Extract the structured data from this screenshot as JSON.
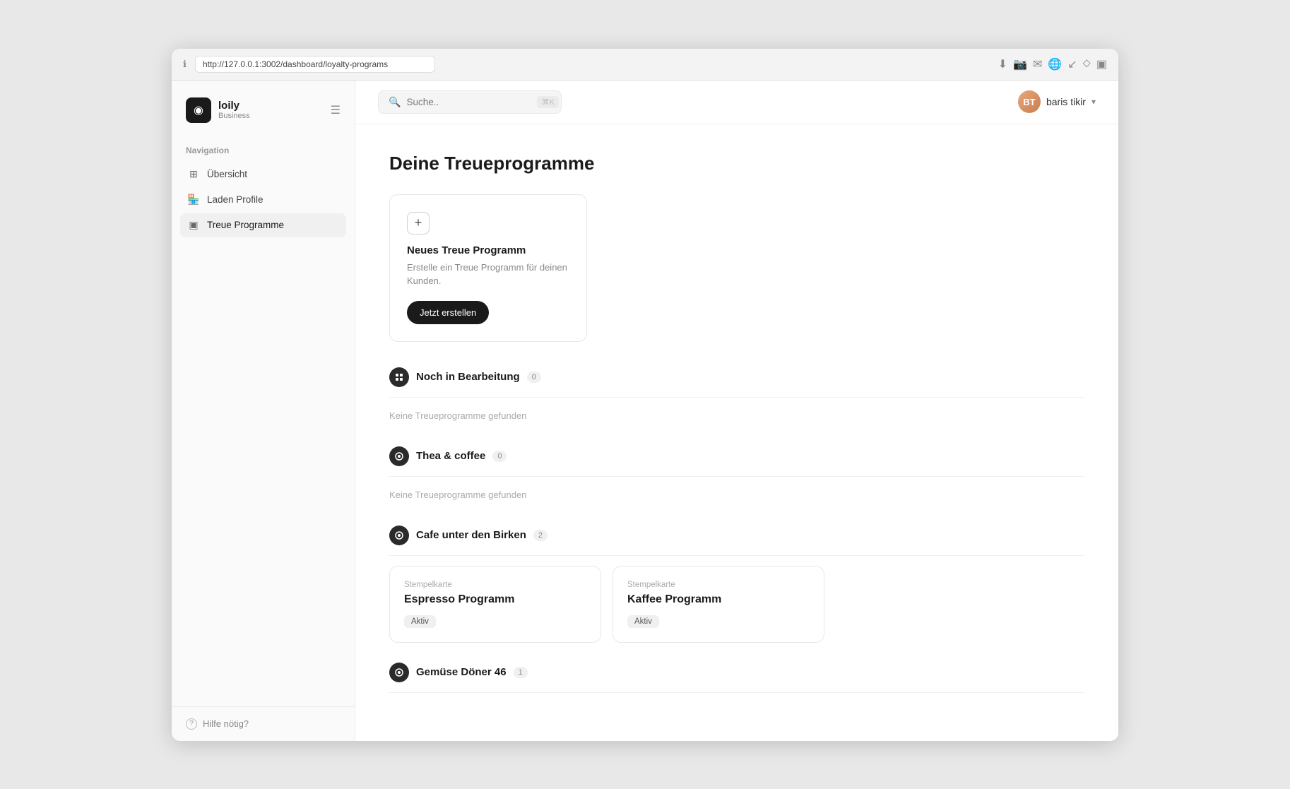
{
  "browser": {
    "url": "http://127.0.0.1:3002/dashboard/loyalty-programs",
    "info_icon": "ℹ",
    "actions": [
      "📥",
      "📷",
      "✉",
      "🌐",
      "↓",
      "⬦",
      "▣"
    ]
  },
  "sidebar": {
    "logo": {
      "icon": "◉",
      "name": "loily",
      "subtitle": "Business"
    },
    "toggle_icon": "☰",
    "nav_section_label": "Navigation",
    "nav_items": [
      {
        "id": "ubersicht",
        "label": "Übersicht",
        "icon": "⊞",
        "active": false
      },
      {
        "id": "laden-profile",
        "label": "Laden Profile",
        "icon": "🏪",
        "active": false
      },
      {
        "id": "treue-programme",
        "label": "Treue Programme",
        "icon": "▣",
        "active": true
      }
    ],
    "help": {
      "icon": "?",
      "label": "Hilfe nötig?"
    }
  },
  "topbar": {
    "search": {
      "placeholder": "Suche..",
      "shortcut": "⌘K"
    },
    "user": {
      "name": "baris tikir",
      "avatar_initials": "BT"
    }
  },
  "page": {
    "title": "Deine Treueprogramme",
    "new_card": {
      "plus": "+",
      "title": "Neues Treue Programm",
      "description": "Erstelle ein Treue Programm für deinen Kunden.",
      "cta": "Jetzt erstellen"
    },
    "stores": [
      {
        "id": "noch-in-bearbeitung",
        "name": "Noch in Bearbeitung",
        "count": "0",
        "empty_text": "Keine Treueprogramme gefunden",
        "programs": []
      },
      {
        "id": "thea-coffee",
        "name": "Thea & coffee",
        "count": "0",
        "empty_text": "Keine Treueprogramme gefunden",
        "programs": []
      },
      {
        "id": "cafe-unter-den-birken",
        "name": "Cafe unter den Birken",
        "count": "2",
        "empty_text": "",
        "programs": [
          {
            "type": "Stempelkarte",
            "name": "Espresso Programm",
            "status": "Aktiv"
          },
          {
            "type": "Stempelkarte",
            "name": "Kaffee Programm",
            "status": "Aktiv"
          }
        ]
      },
      {
        "id": "gemuse-doner-46",
        "name": "Gemüse Döner 46",
        "count": "1",
        "empty_text": "",
        "programs": []
      }
    ]
  }
}
